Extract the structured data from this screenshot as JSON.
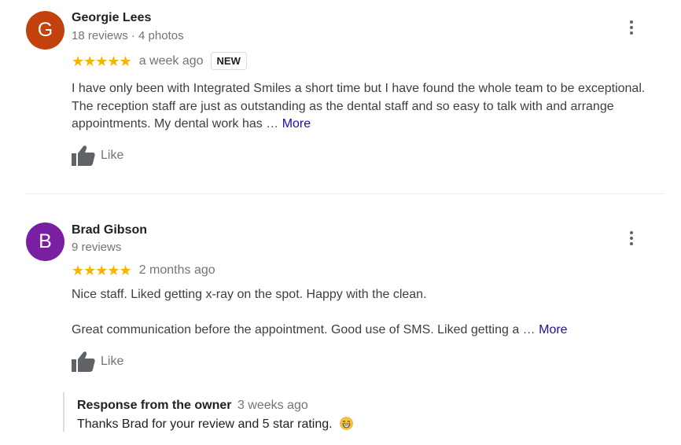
{
  "reviews": [
    {
      "avatar_letter": "G",
      "avatar_color": "#c2410c",
      "name": "Georgie Lees",
      "meta": "18 reviews · 4 photos",
      "stars": "★★★★★",
      "rating": 5,
      "when": "a week ago",
      "badge": "NEW",
      "text": "I have only been with Integrated Smiles a short time but I have found the whole team to be exceptional. The reception staff are just as outstanding as the dental staff and so easy to talk with and arrange appointments. My dental work has … ",
      "more": "More",
      "like": "Like",
      "icons": {
        "like": "thumbs-up-icon",
        "menu": "more-vert-icon"
      }
    },
    {
      "avatar_letter": "B",
      "avatar_color": "#7b1fa2",
      "name": "Brad Gibson",
      "meta": "9 reviews",
      "stars": "★★★★★",
      "rating": 5,
      "when": "2 months ago",
      "text_line1": "Nice staff. Liked getting x-ray on the spot. Happy with the clean.",
      "text_line2": "Great communication before the appointment. Good use of SMS. Liked getting a … ",
      "more": "More",
      "like": "Like",
      "response": {
        "title": "Response from the owner",
        "when": "3 weeks ago",
        "text": "Thanks Brad for your review and 5 star rating.",
        "emoji": "grinning-face-emoji"
      },
      "icons": {
        "like": "thumbs-up-icon",
        "menu": "more-vert-icon"
      }
    }
  ],
  "colors": {
    "star": "#f5b400",
    "link": "#1a0dab",
    "secondary_text": "#70757a"
  }
}
